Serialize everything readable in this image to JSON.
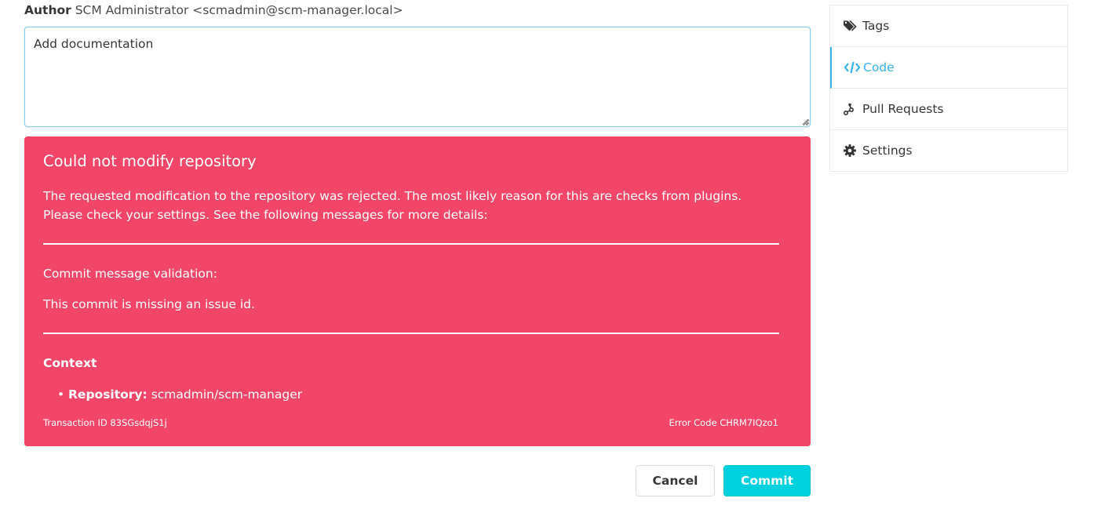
{
  "author": {
    "label": "Author",
    "value": "SCM Administrator <scmadmin@scm-manager.local>"
  },
  "commit_message": {
    "value": "Add documentation"
  },
  "error": {
    "title": "Could not modify repository",
    "description": "The requested modification to the repository was rejected. The most likely reason for this are checks from plugins. Please check your settings. See the following messages for more details:",
    "validation_label": "Commit message validation:",
    "validation_message": "This commit is missing an issue id.",
    "context_title": "Context",
    "context_items": [
      {
        "key": "Repository:",
        "value": "scmadmin/scm-manager"
      }
    ],
    "transaction_id": "Transaction ID 83SGsdqjS1j",
    "error_code": "Error Code CHRM7IQzo1",
    "color": "#f14668"
  },
  "buttons": {
    "cancel": "Cancel",
    "commit": "Commit",
    "commit_color": "#00d1df"
  },
  "side_menu": {
    "active_color": "#33b2e8",
    "items": [
      {
        "label": "Tags",
        "icon": "tags-icon",
        "active": false
      },
      {
        "label": "Code",
        "icon": "code-icon",
        "active": true
      },
      {
        "label": "Pull Requests",
        "icon": "pull-request-icon",
        "active": false
      },
      {
        "label": "Settings",
        "icon": "gear-icon",
        "active": false
      }
    ]
  }
}
